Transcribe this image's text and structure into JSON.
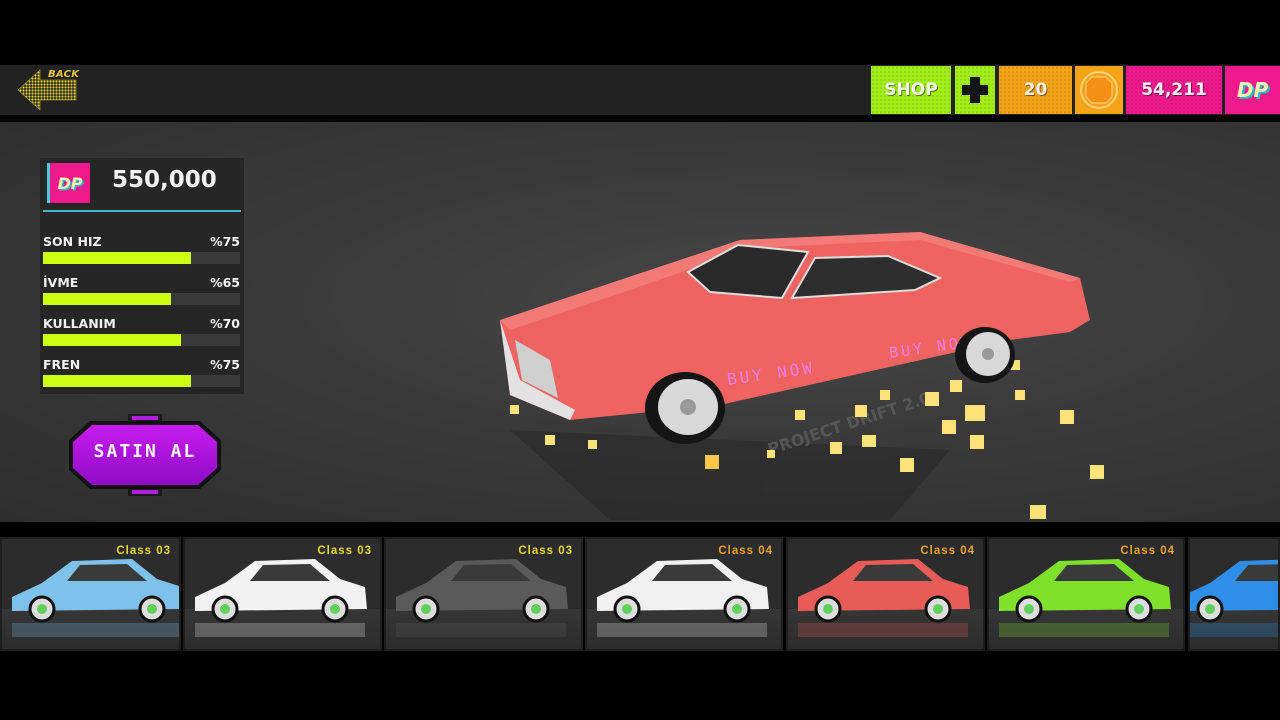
{
  "topbar": {
    "back_label": "BACK",
    "shop_label": "SHOP",
    "plus_icon": "plus-icon",
    "coins": "20",
    "coin_icon": "coin-icon",
    "dp_balance": "54,211",
    "dp_icon": "DP",
    "colors": {
      "shop": "#a2ee18",
      "coins": "#f5a418",
      "dp": "#ef1a8c"
    }
  },
  "car_details": {
    "currency_icon": "DP",
    "price": "550,000",
    "stats": [
      {
        "label": "SON HIZ",
        "value_text": "%75",
        "value": 75
      },
      {
        "label": "İVME",
        "value_text": "%65",
        "value": 65
      },
      {
        "label": "KULLANIM",
        "value_text": "%70",
        "value": 70
      },
      {
        "label": "FREN",
        "value_text": "%75",
        "value": 75
      }
    ],
    "buy_label": "SATIN AL",
    "car_overlay_text": "BUY NOW",
    "watermark": "PROJECT DRIFT 2.0",
    "car_color": "#ef6461"
  },
  "car_list": [
    {
      "class": "Class 03",
      "color": "#7ec2ec",
      "class_color": "#e6d830"
    },
    {
      "class": "Class 03",
      "color": "#f2f2f2",
      "class_color": "#e6d830"
    },
    {
      "class": "Class 03",
      "color": "#5a5a5a",
      "class_color": "#e6d830"
    },
    {
      "class": "Class 04",
      "color": "#f0f0f0",
      "class_color": "#f0a020"
    },
    {
      "class": "Class 04",
      "color": "#e85c58",
      "class_color": "#f0a020"
    },
    {
      "class": "Class 04",
      "color": "#7ee02a",
      "class_color": "#f0a020"
    },
    {
      "class": "",
      "color": "#2f8ee8",
      "class_color": "#f0a020"
    }
  ]
}
